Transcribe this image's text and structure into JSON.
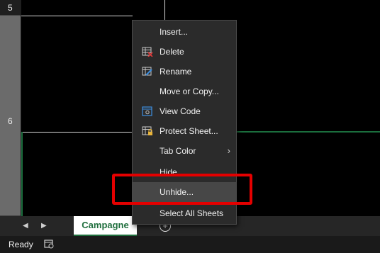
{
  "row_headers": [
    "5",
    "6"
  ],
  "sheet_tab": "Campagne",
  "add_sheet_symbol": "+",
  "nav_left": "◀",
  "nav_right": "▶",
  "status": "Ready",
  "menu": {
    "insert": "Insert...",
    "delete": "Delete",
    "rename": "Rename",
    "move_copy": "Move or Copy...",
    "view_code": "View Code",
    "protect_sheet": "Protect Sheet...",
    "tab_color": "Tab Color",
    "hide": "Hide",
    "unhide": "Unhide...",
    "select_all": "Select All Sheets",
    "submenu_arrow": "›"
  },
  "colors": {
    "accent_green": "#1f6e3d",
    "highlight_red": "#e40000"
  },
  "icons": [
    "delete-sheet-icon",
    "rename-sheet-icon",
    "view-code-icon",
    "protect-sheet-icon",
    "page-layout-status-icon"
  ]
}
